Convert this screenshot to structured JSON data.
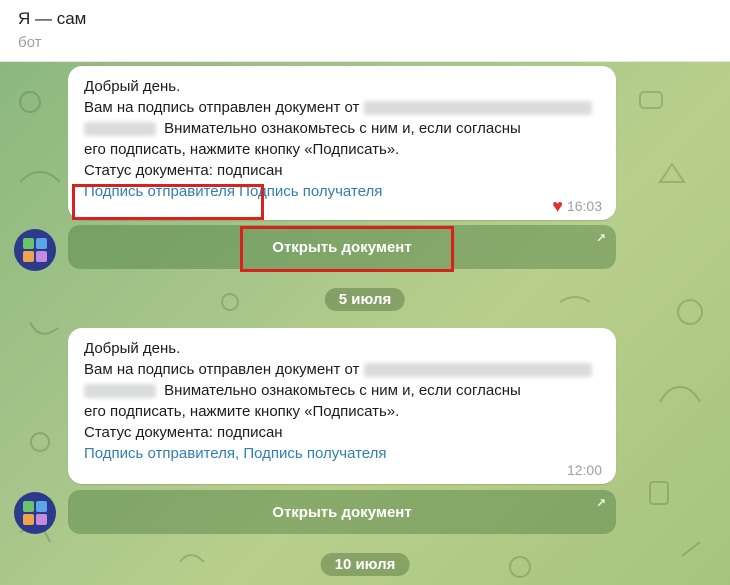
{
  "header": {
    "title": "Я — сам",
    "subtitle": "бот"
  },
  "messages": [
    {
      "greeting": "Добрый день.",
      "line2_prefix": "Вам на подпись отправлен документ от",
      "line3_suffix": "Внимательно ознакомьтесь с ним и, если согласны",
      "line4": "его подписать, нажмите кнопку «Подписать».",
      "status": "Статус документа: подписан",
      "link_sender": "Подпись отправителя",
      "separator": " ",
      "link_receiver": "Подпись получателя",
      "reaction": "heart",
      "time": "16:03",
      "button_label": "Открыть документ"
    },
    {
      "greeting": "Добрый день.",
      "line2_prefix": "Вам на подпись отправлен документ от",
      "line3_suffix": "Внимательно ознакомьтесь с ним и, если согласны",
      "line4": "его подписать, нажмите кнопку «Подписать».",
      "status": "Статус документа: подписан",
      "link_sender": "Подпись отправителя",
      "separator": ", ",
      "link_receiver": "Подпись получателя",
      "time": "12:00",
      "button_label": "Открыть документ"
    }
  ],
  "dates": {
    "first": "5 июля",
    "second": "10 июля"
  },
  "colors": {
    "link": "#2f7fb3",
    "highlight": "#d9211e",
    "heart": "#e03131"
  }
}
